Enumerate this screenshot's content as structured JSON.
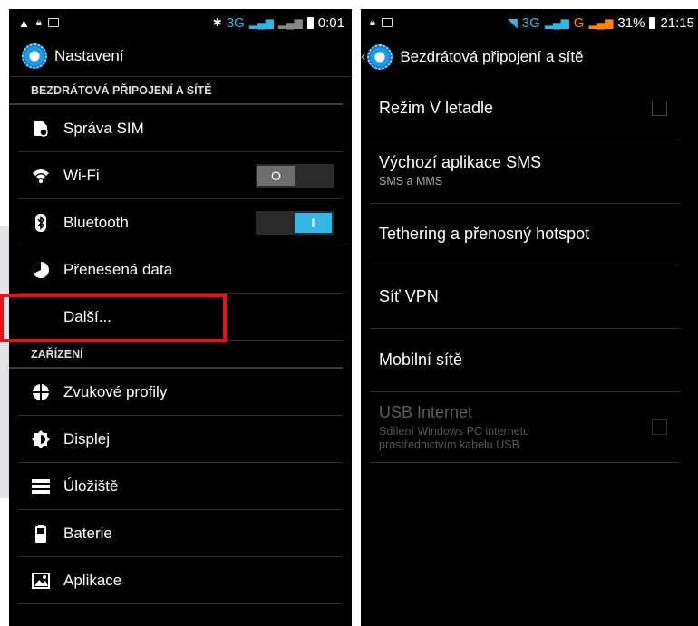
{
  "colors": {
    "accent": "#33b5e5",
    "highlight": "#e8121c",
    "network_orange": "#ff8800"
  },
  "left": {
    "status": {
      "network": "3G",
      "time": "0:01"
    },
    "title": "Nastavení",
    "sections": [
      {
        "header": "BEZDRÁTOVÁ PŘIPOJENÍ A SÍTĚ",
        "items": [
          {
            "label": "Správa SIM",
            "icon": "sim-settings-icon"
          },
          {
            "label": "Wi-Fi",
            "icon": "wifi-icon",
            "toggle": "off",
            "toggle_label": "O"
          },
          {
            "label": "Bluetooth",
            "icon": "bluetooth-icon",
            "toggle": "on",
            "toggle_label": "I"
          },
          {
            "label": "Přenesená data",
            "icon": "data-usage-icon"
          },
          {
            "label": "Další...",
            "icon": ""
          }
        ]
      },
      {
        "header": "ZAŘÍZENÍ",
        "items": [
          {
            "label": "Zvukové profily",
            "icon": "audio-profiles-icon"
          },
          {
            "label": "Displej",
            "icon": "display-icon"
          },
          {
            "label": "Úložiště",
            "icon": "storage-icon"
          },
          {
            "label": "Baterie",
            "icon": "battery-icon"
          },
          {
            "label": "Aplikace",
            "icon": "apps-icon"
          }
        ]
      }
    ]
  },
  "right": {
    "status": {
      "network": "3G",
      "network2": "G",
      "battery": "31%",
      "time": "21:15"
    },
    "title": "Bezdrátová připojení a sítě",
    "items": [
      {
        "title": "Režim V letadle",
        "checkbox": true
      },
      {
        "title": "Výchozí aplikace SMS",
        "subtitle": "SMS a MMS"
      },
      {
        "title": "Tethering a přenosný hotspot"
      },
      {
        "title": "Síť VPN"
      },
      {
        "title": "Mobilní sítě"
      },
      {
        "title": "USB Internet",
        "subtitle": "Sdílení Windows PC internetu prostřednictvím kabelu USB",
        "checkbox": true,
        "disabled": true
      }
    ]
  }
}
